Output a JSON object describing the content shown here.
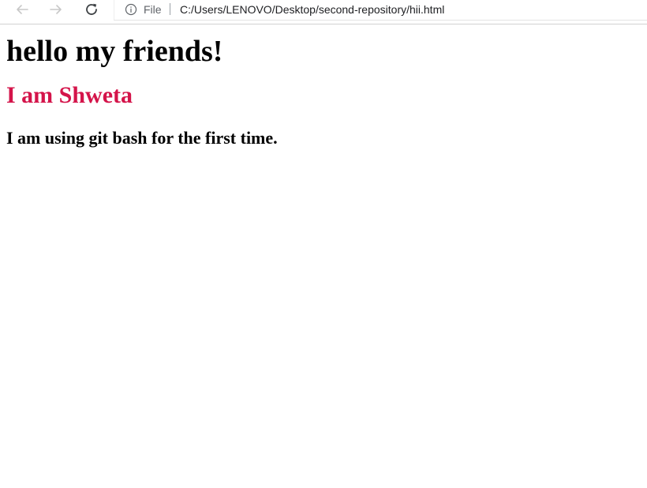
{
  "browser": {
    "back_icon": "arrow-left-icon",
    "forward_icon": "arrow-right-icon",
    "reload_icon": "reload-icon",
    "info_icon": "info-circle-icon",
    "scheme_label": "File",
    "url": "C:/Users/LENOVO/Desktop/second-repository/hii.html"
  },
  "page": {
    "heading": "hello my friends!",
    "subheading": "I am Shweta",
    "subheading_color": "#d4144a",
    "text": "I am using git bash for the first time."
  }
}
